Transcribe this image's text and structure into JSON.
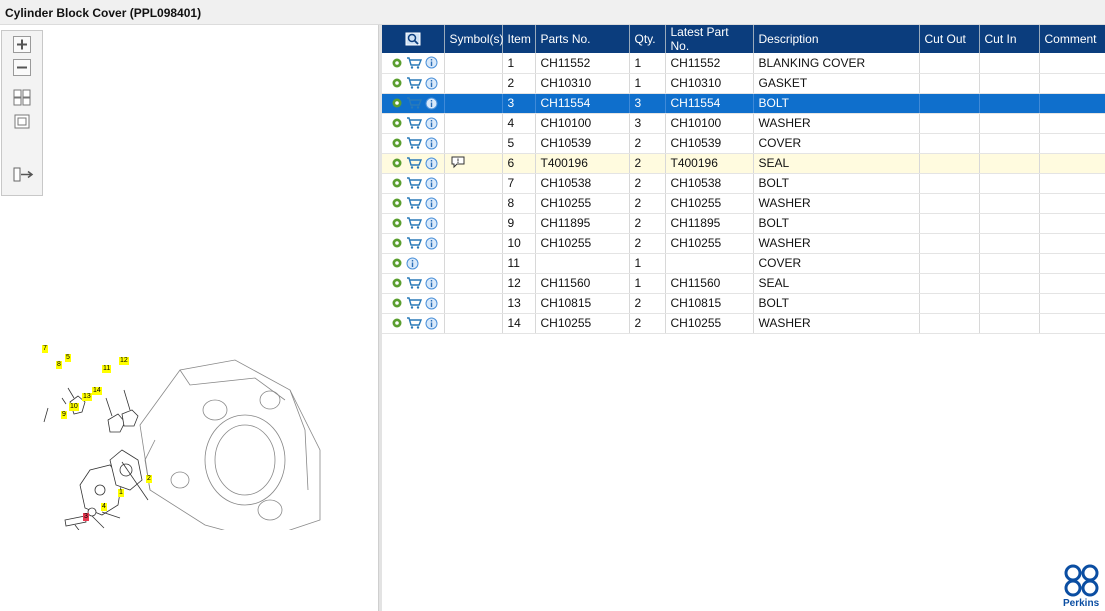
{
  "window": {
    "title": "Cylinder Block Cover (PPL098401)"
  },
  "toolbar": {
    "buttons": [
      {
        "name": "zoom-in-icon"
      },
      {
        "name": "zoom-out-icon"
      },
      {
        "name": "fit-all-icon"
      },
      {
        "name": "actual-size-icon"
      },
      {
        "name": "toggle-list-icon"
      }
    ]
  },
  "diagram": {
    "callouts": [
      "7",
      "8",
      "5",
      "11",
      "12",
      "13",
      "14",
      "10",
      "9",
      "2",
      "1",
      "4",
      "3"
    ],
    "highlight_color": "#ffff00",
    "selected_color": "#e8384f"
  },
  "table": {
    "columns": [
      "",
      "Symbol(s)",
      "Item",
      "Parts No.",
      "Qty.",
      "Latest Part No.",
      "Description",
      "Cut Out",
      "Cut In",
      "Comment"
    ],
    "rows": [
      {
        "item": "1",
        "part": "CH11552",
        "qty": "1",
        "latest": "CH11552",
        "desc": "BLANKING COVER",
        "cart": true,
        "symbol": "",
        "state": ""
      },
      {
        "item": "2",
        "part": "CH10310",
        "qty": "1",
        "latest": "CH10310",
        "desc": "GASKET",
        "cart": true,
        "symbol": "",
        "state": ""
      },
      {
        "item": "3",
        "part": "CH11554",
        "qty": "3",
        "latest": "CH11554",
        "desc": "BOLT",
        "cart": true,
        "symbol": "",
        "state": "selected"
      },
      {
        "item": "4",
        "part": "CH10100",
        "qty": "3",
        "latest": "CH10100",
        "desc": "WASHER",
        "cart": true,
        "symbol": "",
        "state": ""
      },
      {
        "item": "5",
        "part": "CH10539",
        "qty": "2",
        "latest": "CH10539",
        "desc": "COVER",
        "cart": true,
        "symbol": "",
        "state": ""
      },
      {
        "item": "6",
        "part": "T400196",
        "qty": "2",
        "latest": "T400196",
        "desc": "SEAL",
        "cart": true,
        "symbol": "note",
        "state": "highlight"
      },
      {
        "item": "7",
        "part": "CH10538",
        "qty": "2",
        "latest": "CH10538",
        "desc": "BOLT",
        "cart": true,
        "symbol": "",
        "state": ""
      },
      {
        "item": "8",
        "part": "CH10255",
        "qty": "2",
        "latest": "CH10255",
        "desc": "WASHER",
        "cart": true,
        "symbol": "",
        "state": ""
      },
      {
        "item": "9",
        "part": "CH11895",
        "qty": "2",
        "latest": "CH11895",
        "desc": "BOLT",
        "cart": true,
        "symbol": "",
        "state": ""
      },
      {
        "item": "10",
        "part": "CH10255",
        "qty": "2",
        "latest": "CH10255",
        "desc": "WASHER",
        "cart": true,
        "symbol": "",
        "state": ""
      },
      {
        "item": "11",
        "part": "",
        "qty": "1",
        "latest": "",
        "desc": "COVER",
        "cart": false,
        "symbol": "",
        "state": ""
      },
      {
        "item": "12",
        "part": "CH11560",
        "qty": "1",
        "latest": "CH11560",
        "desc": "SEAL",
        "cart": true,
        "symbol": "",
        "state": ""
      },
      {
        "item": "13",
        "part": "CH10815",
        "qty": "2",
        "latest": "CH10815",
        "desc": "BOLT",
        "cart": true,
        "symbol": "",
        "state": ""
      },
      {
        "item": "14",
        "part": "CH10255",
        "qty": "2",
        "latest": "CH10255",
        "desc": "WASHER",
        "cart": true,
        "symbol": "",
        "state": ""
      }
    ]
  },
  "brand": {
    "name": "Perkins",
    "color": "#0b4ea2"
  }
}
